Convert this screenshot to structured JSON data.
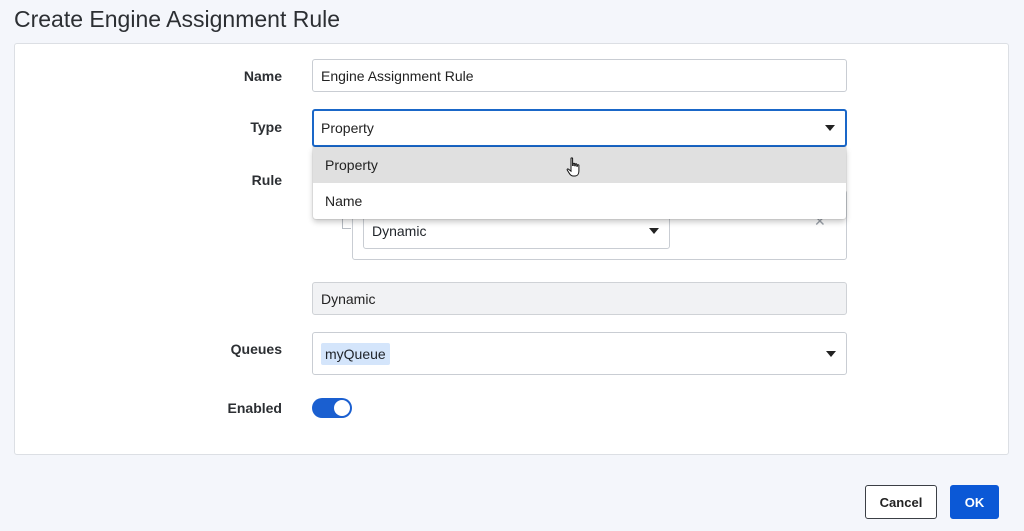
{
  "dialog": {
    "title": "Create Engine Assignment Rule"
  },
  "form": {
    "name_label": "Name",
    "name_value": "Engine Assignment Rule",
    "type_label": "Type",
    "type_value": "Property",
    "type_options": [
      "Property",
      "Name"
    ],
    "rule_label": "Rule",
    "rule_select_value": "Dynamic",
    "rule_text_value": "Dynamic",
    "queues_label": "Queues",
    "queues_tag": "myQueue",
    "enabled_label": "Enabled",
    "enabled": true
  },
  "footer": {
    "cancel_label": "Cancel",
    "ok_label": "OK"
  },
  "colors": {
    "accent": "#0b58d6",
    "toggle_on": "#1a5fd0",
    "tag_bg": "#d4e5fb"
  }
}
